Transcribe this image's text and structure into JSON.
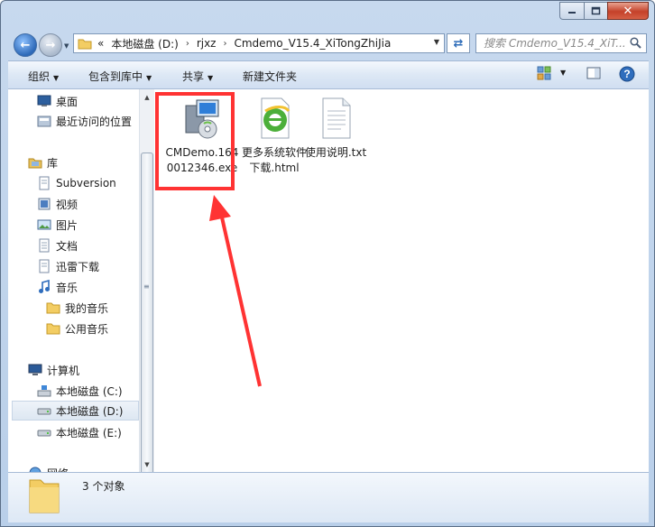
{
  "window": {
    "caption": {
      "minimize": "─",
      "maximize": "□",
      "close": "✕"
    }
  },
  "address": {
    "overflow": "«",
    "segments": [
      "本地磁盘 (D:)",
      "rjxz",
      "Cmdemo_V15.4_XiTongZhiJia"
    ],
    "separator": "›"
  },
  "search": {
    "placeholder": "搜索 Cmdemo_V15.4_XiT..."
  },
  "toolbar": {
    "organize": "组织",
    "include_library": "包含到库中",
    "share": "共享",
    "new_folder": "新建文件夹"
  },
  "sidebar": {
    "items": [
      {
        "label": "桌面",
        "icon": "desktop-icon"
      },
      {
        "label": "最近访问的位置",
        "icon": "recent-places-icon"
      },
      {
        "label": "库",
        "icon": "library-icon"
      },
      {
        "label": "Subversion",
        "icon": "document-library-icon"
      },
      {
        "label": "视频",
        "icon": "video-library-icon"
      },
      {
        "label": "图片",
        "icon": "picture-library-icon"
      },
      {
        "label": "文档",
        "icon": "document-library-icon"
      },
      {
        "label": "迅雷下载",
        "icon": "document-library-icon"
      },
      {
        "label": "音乐",
        "icon": "music-library-icon"
      },
      {
        "label": "我的音乐",
        "icon": "folder-icon"
      },
      {
        "label": "公用音乐",
        "icon": "folder-icon"
      },
      {
        "label": "计算机",
        "icon": "computer-icon"
      },
      {
        "label": "本地磁盘 (C:)",
        "icon": "system-drive-icon"
      },
      {
        "label": "本地磁盘 (D:)",
        "icon": "drive-icon"
      },
      {
        "label": "本地磁盘 (E:)",
        "icon": "drive-icon"
      },
      {
        "label": "网络",
        "icon": "network-icon"
      }
    ]
  },
  "files": [
    {
      "name": "CMDemo.1640012346.exe",
      "icon": "installer-icon"
    },
    {
      "name": "更多系统软件下载.html",
      "icon": "html-browser-icon"
    },
    {
      "name": "使用说明.txt",
      "icon": "text-file-icon"
    }
  ],
  "status": {
    "count_text": "3 个对象"
  },
  "colors": {
    "highlight": "#ff3333",
    "selection": "#dde7f2"
  }
}
